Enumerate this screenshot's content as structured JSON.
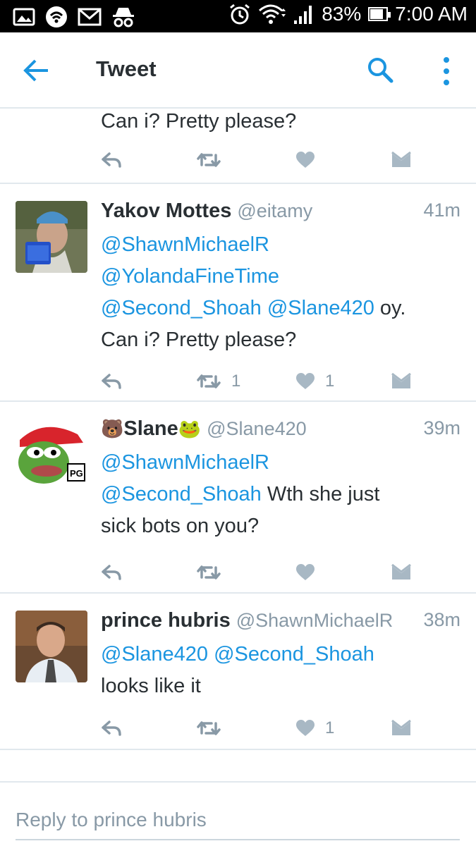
{
  "status_bar": {
    "battery_percent": "83%",
    "battery_level": 0.83,
    "time": "7:00 AM",
    "icons_left": [
      "image-icon",
      "wifi-hotspot-icon",
      "gmail-icon",
      "incognito-icon"
    ],
    "icons_right": [
      "alarm-icon",
      "wifi-icon",
      "signal-icon",
      "battery-icon"
    ]
  },
  "header": {
    "title": "Tweet",
    "icons": [
      "back-arrow-icon",
      "search-icon",
      "more-vertical-icon"
    ]
  },
  "colors": {
    "accent": "#1b95e0",
    "text": "#292f33",
    "muted": "#8899a6",
    "divider": "#e1e8ed"
  },
  "tweets": [
    {
      "text_tail": "Can i? Pretty please?",
      "retweets": "",
      "likes": ""
    },
    {
      "name": "Yakov Mottes",
      "handle": "@eitamy",
      "time": "41m",
      "mentions": [
        "@ShawnMichaelR",
        "@YolandaFineTime",
        "@Second_Shoah",
        "@Slane420"
      ],
      "text_inline": " oy.",
      "text_after": "Can i? Pretty please?",
      "retweets": "1",
      "likes": "1"
    },
    {
      "name_prefix_emoji": "🐻",
      "name": "Slane",
      "name_suffix_emoji": "🐸",
      "handle": "@Slane420",
      "time": "39m",
      "mentions": [
        "@ShawnMichaelR",
        "@Second_Shoah"
      ],
      "text_inline": " Wth she just",
      "text_after": "sick bots on you?",
      "avatar_text": "PG",
      "retweets": "",
      "likes": ""
    },
    {
      "name": "prince hubris",
      "handle": "@ShawnMichaelR",
      "time": "38m",
      "mentions": [
        "@Slane420",
        "@Second_Shoah"
      ],
      "text_after": "looks like it",
      "retweets": "",
      "likes": "1"
    }
  ],
  "reply": {
    "placeholder": "Reply to prince hubris"
  }
}
